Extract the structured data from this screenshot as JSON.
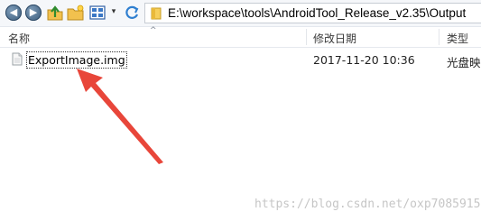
{
  "toolbar": {
    "back_icon": "back-arrow-icon",
    "forward_icon": "forward-arrow-icon",
    "up_icon": "up-folder-icon",
    "new_folder_icon": "new-folder-icon",
    "view_icon": "view-grid-icon",
    "view_caret": "▾",
    "refresh_icon": "refresh-icon"
  },
  "address": {
    "path": "E:\\workspace\\tools\\AndroidTool_Release_v2.35\\Output"
  },
  "columns": {
    "name": "名称",
    "date": "修改日期",
    "type": "类型",
    "sort_indicator": "^"
  },
  "files": [
    {
      "name": "ExportImage.img",
      "date": "2017-11-20 10:36",
      "type": "光盘映"
    }
  ],
  "annotation": {
    "color": "#e8463a"
  },
  "watermark": "https://blog.csdn.net/oxp7085915"
}
